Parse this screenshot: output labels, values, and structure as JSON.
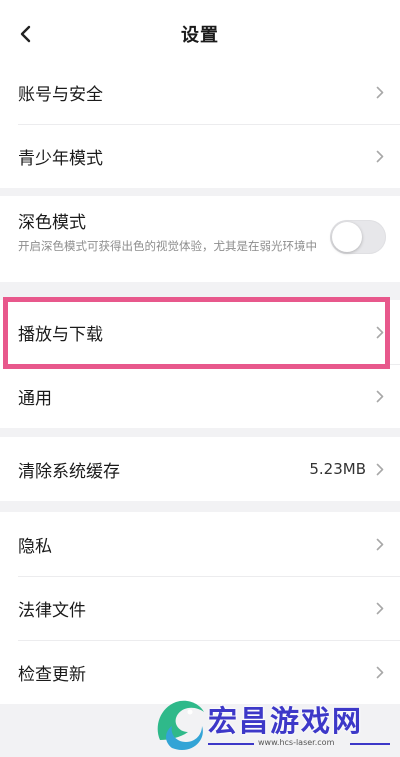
{
  "header": {
    "title": "设置"
  },
  "sections": {
    "account": [
      {
        "label": "账号与安全"
      },
      {
        "label": "青少年模式"
      }
    ],
    "dark_mode": {
      "label": "深色模式",
      "description": "开启深色模式可获得出色的视觉体验，尤其是在弱光环境中",
      "enabled": false
    },
    "media": [
      {
        "label": "播放与下载"
      },
      {
        "label": "通用"
      }
    ],
    "cache": {
      "label": "清除系统缓存",
      "value": "5.23MB"
    },
    "other": [
      {
        "label": "隐私"
      },
      {
        "label": "法律文件"
      },
      {
        "label": "检查更新"
      }
    ]
  },
  "highlighted_item": "播放与下载",
  "watermark": {
    "title": "宏昌游戏网",
    "url": "www.hcs-laser.com"
  },
  "colors": {
    "highlight": "#e8588c",
    "watermark": "#3d38c8",
    "background": "#f2f2f4"
  }
}
